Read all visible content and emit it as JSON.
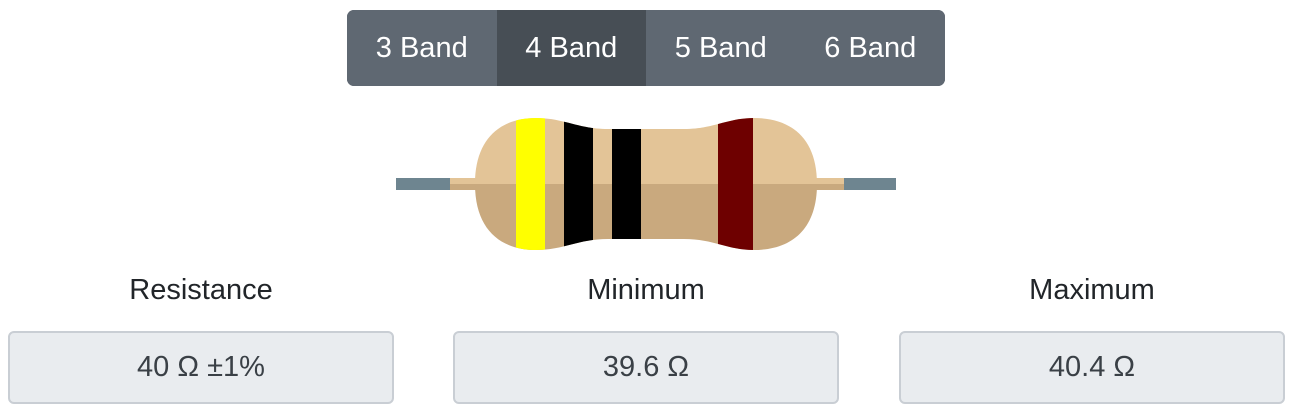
{
  "band_selector": {
    "options": [
      {
        "label": "3 Band",
        "active": false
      },
      {
        "label": "4 Band",
        "active": true
      },
      {
        "label": "5 Band",
        "active": false
      },
      {
        "label": "6 Band",
        "active": false
      }
    ]
  },
  "resistor": {
    "bands": [
      {
        "color_name": "yellow",
        "hex": "#ffff00"
      },
      {
        "color_name": "black",
        "hex": "#000000"
      },
      {
        "color_name": "black",
        "hex": "#000000"
      },
      {
        "color_name": "brown",
        "hex": "#6e0000"
      }
    ],
    "body_color_top": "#e3c497",
    "body_color_bottom": "#c9a97e",
    "lead_color": "#6e8590"
  },
  "results": {
    "resistance": {
      "label": "Resistance",
      "value": "40 Ω ±1%"
    },
    "minimum": {
      "label": "Minimum",
      "value": "39.6 Ω"
    },
    "maximum": {
      "label": "Maximum",
      "value": "40.4 Ω"
    }
  }
}
